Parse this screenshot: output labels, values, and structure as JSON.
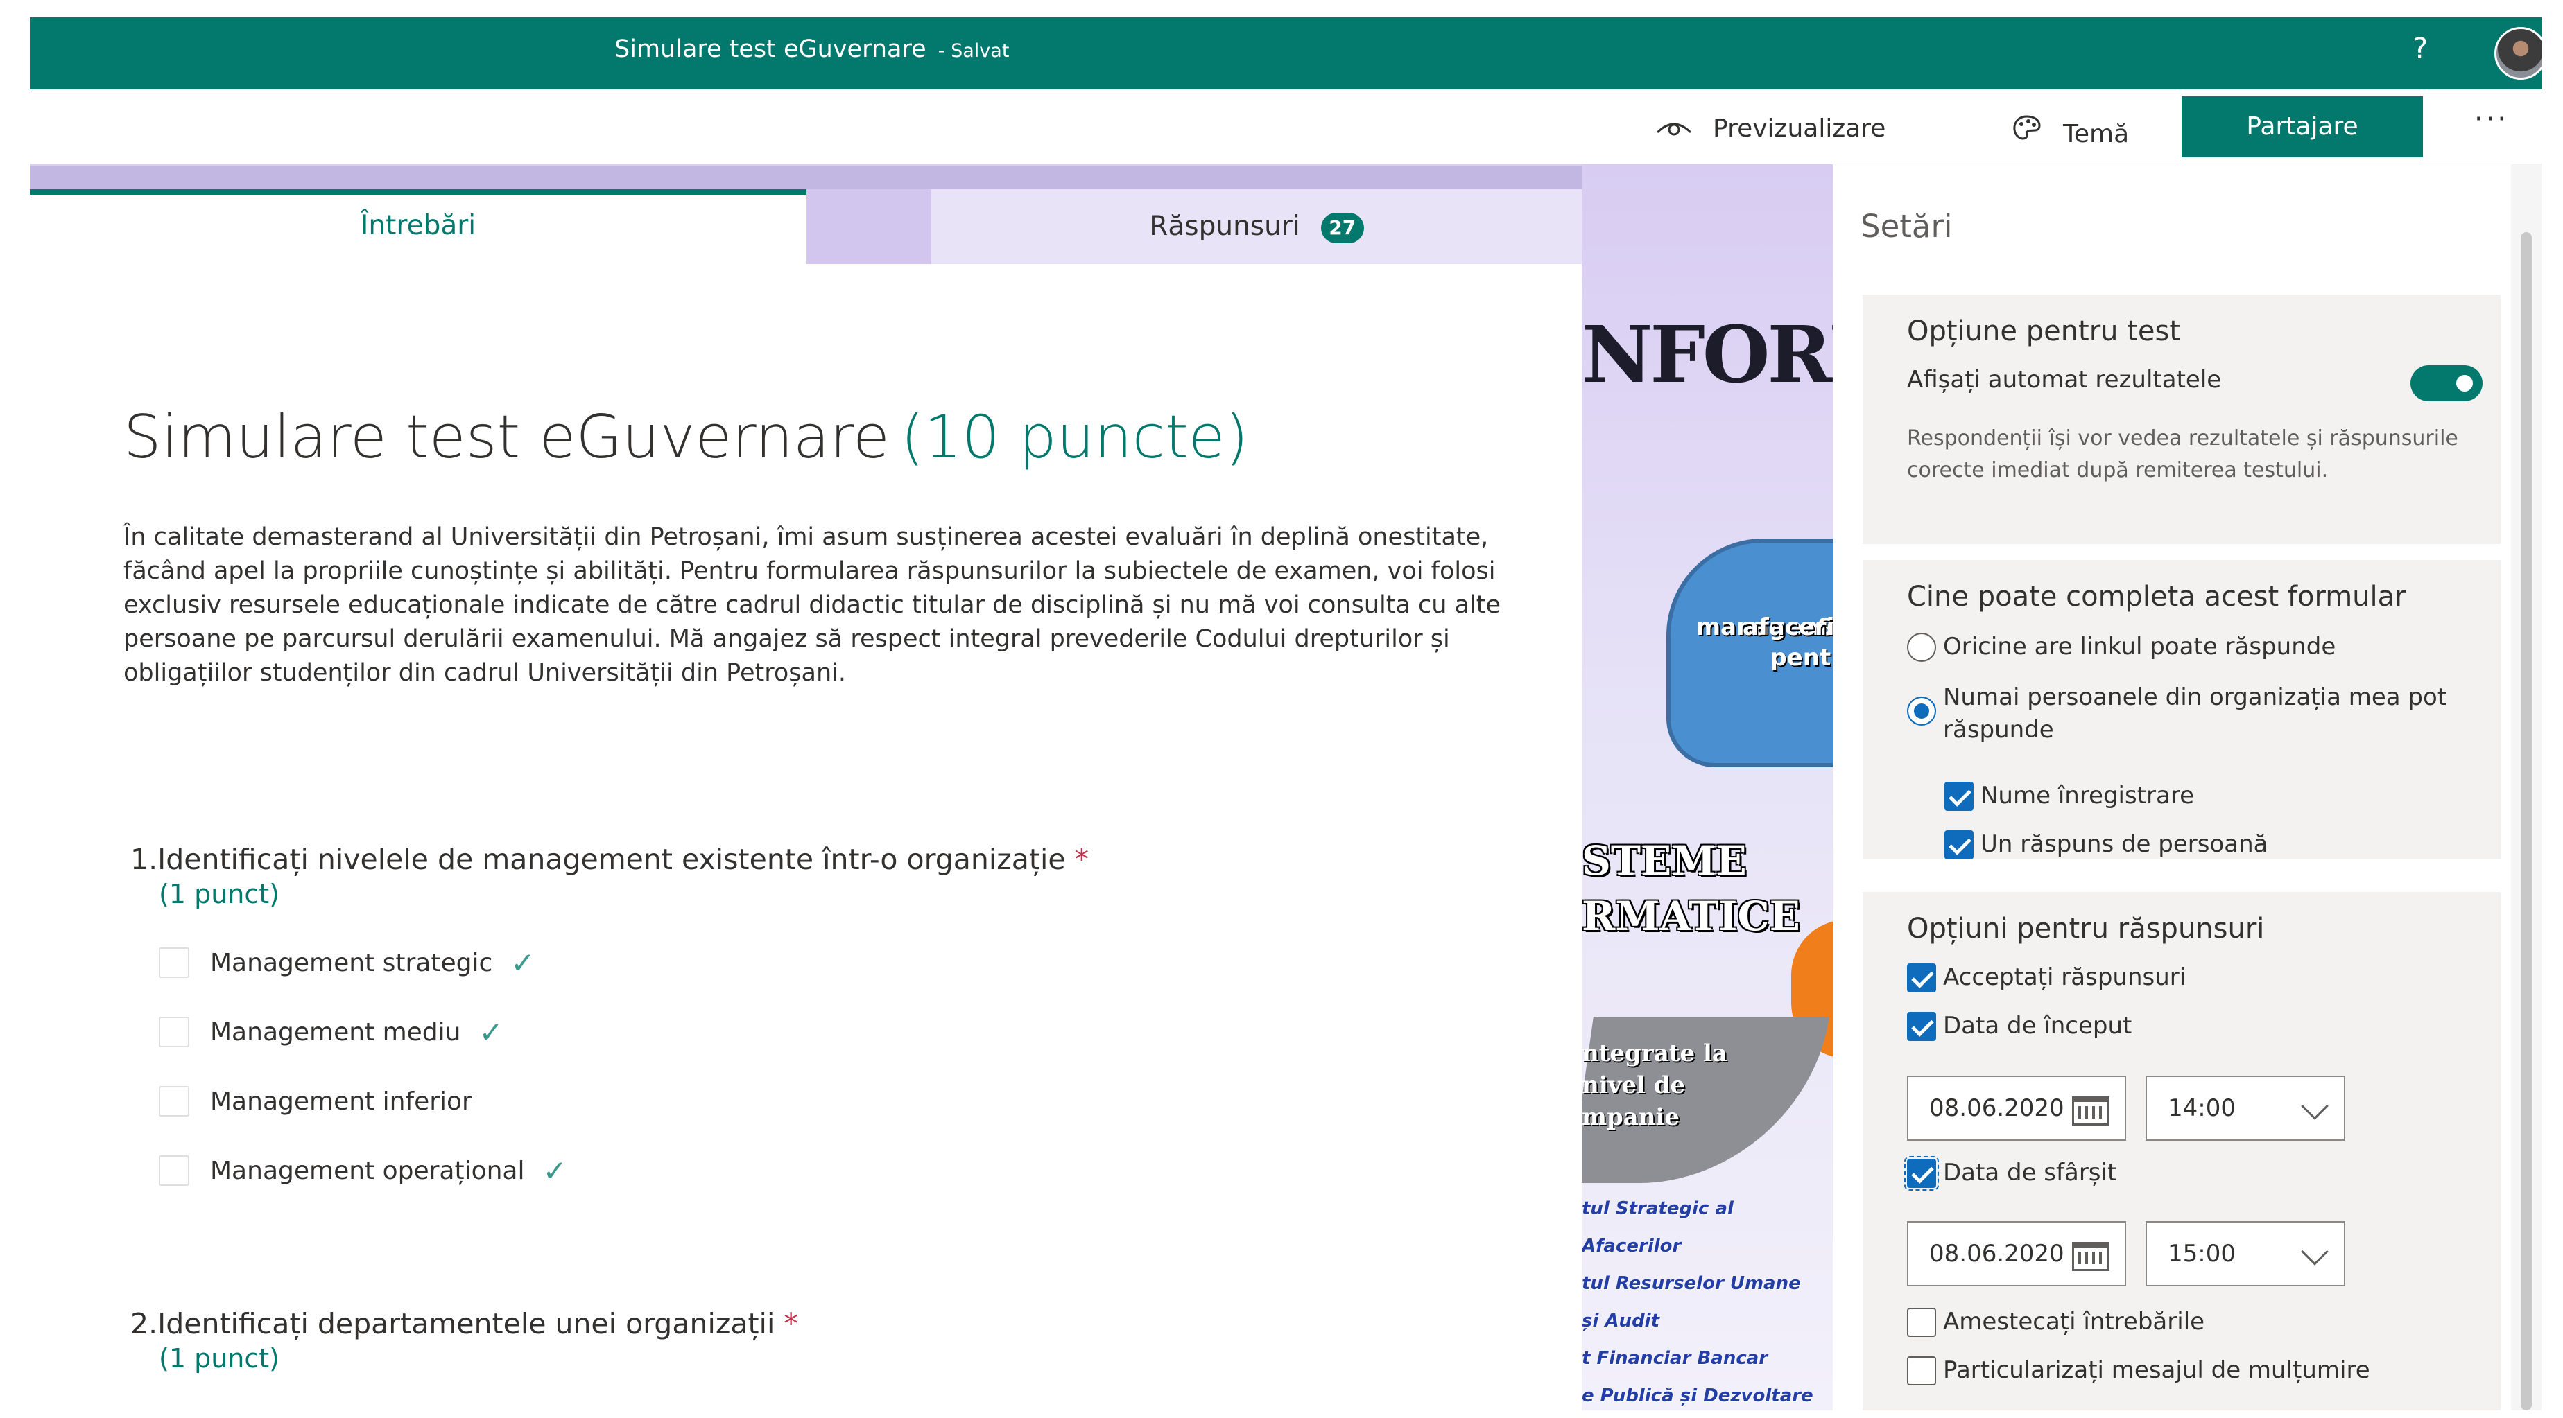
{
  "header": {
    "title": "Simulare test eGuvernare",
    "status": "- Salvat",
    "help": "?"
  },
  "commands": {
    "preview": "Previzualizare",
    "theme": "Temă",
    "share": "Partajare",
    "more": "···"
  },
  "tabs": {
    "questions": "Întrebări",
    "responses": "Răspunsuri",
    "responses_count": "27"
  },
  "banner": {
    "heading": "NFORM",
    "blue_text": [
      "Si pentr",
      "manageme",
      "afaceril"
    ],
    "sisteme": [
      "STEME",
      "RMATICE"
    ],
    "integrate": [
      "ntegrate la",
      "nivel de",
      "mpanie"
    ],
    "links": [
      "tul Strategic al Afacerilor",
      "tul Resurselor Umane",
      "și Audit",
      "t Financiar Bancar",
      "e Publică și Dezvoltare Ec"
    ]
  },
  "form": {
    "title": "Simulare test eGuvernare",
    "points": "(10 puncte)",
    "description": "În calitate demasterand al Universității din Petroșani, îmi asum susținerea acestei evaluări în deplină onestitate, făcând apel la propriile cunoștințe și abilități. Pentru formularea răspunsurilor la subiectele de examen, voi folosi exclusiv resursele educaționale indicate de către cadrul didactic titular de disciplină și nu mă voi consulta cu alte persoane pe parcursul derulării examenului. Mă angajez să respect integral prevederile Codului drepturilor și obligațiilor studenților din cadrul Universității din Petroșani.",
    "questions": [
      {
        "number": "1.",
        "text": "Identificați nivelele de management existente într-o organizație",
        "required": "*",
        "points": "(1 punct)",
        "options": [
          {
            "label": "Management strategic",
            "correct": true
          },
          {
            "label": "Management mediu",
            "correct": true
          },
          {
            "label": "Management inferior",
            "correct": false
          },
          {
            "label": "Management operațional",
            "correct": true
          }
        ]
      },
      {
        "number": "2.",
        "text": "Identificați departamentele unei organizații",
        "required": "*",
        "points": "(1 punct)"
      }
    ]
  },
  "settings": {
    "title": "Setări",
    "test_option": {
      "title": "Opțiune pentru test",
      "auto_results": "Afișați automat rezultatele",
      "auto_results_on": true,
      "help": "Respondenții își vor vedea rezultatele și răspunsurile corecte imediat după remiterea testului."
    },
    "who": {
      "title": "Cine poate completa acest formular",
      "anyone": "Oricine are linkul poate răspunde",
      "org_only": "Numai persoanele din organizația mea pot răspunde",
      "record_name": "Nume înregistrare",
      "one_response": "Un răspuns de persoană"
    },
    "response_options": {
      "title": "Opțiuni pentru răspunsuri",
      "accept": "Acceptați răspunsuri",
      "start_date": "Data de început",
      "start_date_value": "08.06.2020",
      "start_time_value": "14:00",
      "end_date": "Data de sfârșit",
      "end_date_value": "08.06.2020",
      "end_time_value": "15:00",
      "shuffle": "Amestecați întrebările",
      "thanks": "Particularizați mesajul de mulțumire"
    }
  }
}
